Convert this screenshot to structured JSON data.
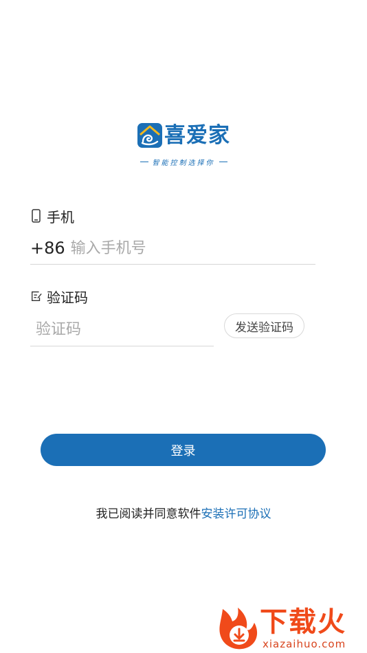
{
  "brand": {
    "name": "喜爱家",
    "slogan": "智能控制选择你",
    "color": "#1b6fb6"
  },
  "phone": {
    "label": "手机",
    "icon": "phone-icon",
    "prefix": "+86",
    "placeholder": "输入手机号",
    "value": ""
  },
  "code": {
    "label": "验证码",
    "icon": "edit-icon",
    "placeholder": "验证码",
    "value": "",
    "send_button": "发送验证码"
  },
  "login_button": "登录",
  "agreement": {
    "text": "我已阅读并同意软件",
    "link": "安装许可协议"
  },
  "watermark": {
    "title": "下载火",
    "url": "xiazaihuo.com",
    "color": "#f04a1a",
    "icon": "flame-download-icon"
  }
}
